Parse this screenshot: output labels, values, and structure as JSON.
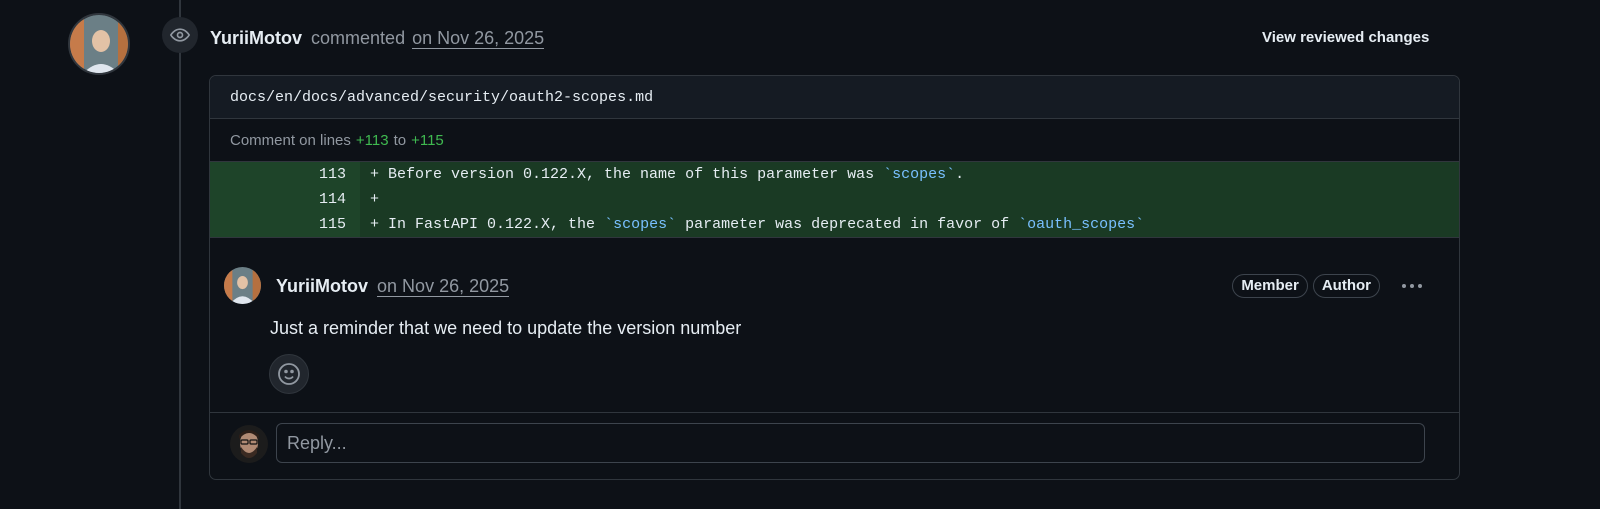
{
  "review": {
    "author": "YuriiMotov",
    "action": "commented",
    "date": "on Nov 26, 2025",
    "view_changes_label": "View reviewed changes",
    "event_icon": "eye-icon"
  },
  "file": {
    "path": "docs/en/docs/advanced/security/oauth2-scopes.md",
    "caption_prefix": "Comment on lines",
    "line_start": "+113",
    "caption_to": "to",
    "line_end": "+115"
  },
  "diff": {
    "rows": [
      {
        "num": "113",
        "prefix": "+ ",
        "before": "Before version 0.122.X, the name of this parameter was ",
        "code1": "`scopes`",
        "middle": ".",
        "code2": "",
        "after": ""
      },
      {
        "num": "114",
        "prefix": "+ ",
        "before": "",
        "code1": "",
        "middle": "",
        "code2": "",
        "after": ""
      },
      {
        "num": "115",
        "prefix": "+ ",
        "before": "In FastAPI 0.122.X, the ",
        "code1": "`scopes`",
        "middle": " parameter was deprecated in favor of ",
        "code2": "`oauth_scopes`",
        "after": ""
      }
    ]
  },
  "comment": {
    "author": "YuriiMotov",
    "date": "on Nov 26, 2025",
    "badges": [
      "Member",
      "Author"
    ],
    "body": "Just a reminder that we need to update the version number",
    "menu_icon": "kebab-horizontal-icon",
    "reaction_icon": "smiley-icon"
  },
  "reply": {
    "placeholder": "Reply..."
  },
  "colors": {
    "background": "#0d1117",
    "added_line": "#1a3a24",
    "added_num": "#1e4429",
    "added_text": "#3fb950",
    "code_token": "#79c0ff",
    "muted": "#9198a1",
    "border": "#30363d"
  }
}
